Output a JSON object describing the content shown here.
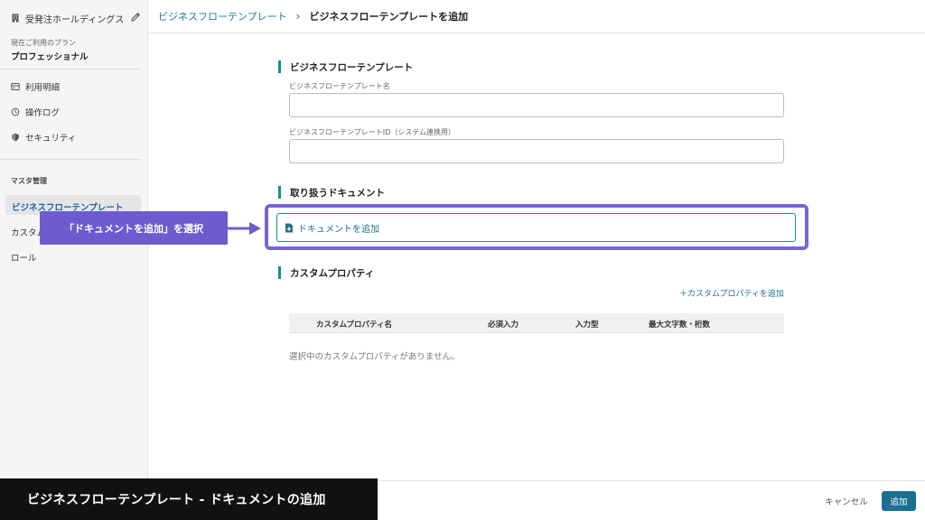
{
  "sidebar": {
    "org_name": "受発注ホールディングス",
    "plan_label": "現在ご利用のプラン",
    "plan_value": "プロフェッショナル",
    "nav": [
      {
        "label": "利用明細",
        "icon": "billing-icon"
      },
      {
        "label": "操作ログ",
        "icon": "history-icon"
      },
      {
        "label": "セキュリティ",
        "icon": "shield-icon"
      }
    ],
    "master_label": "マスタ管理",
    "master_items": [
      "ビジネスフローテンプレート",
      "カスタム",
      "ロール"
    ],
    "active_index": 0
  },
  "breadcrumb": {
    "parent": "ビジネスフローテンプレート",
    "current": "ビジネスフローテンプレートを追加"
  },
  "form": {
    "section1_title": "ビジネスフローテンプレート",
    "name_label": "ビジネスフローテンプレート名",
    "name_value": "",
    "id_label": "ビジネスフローテンプレートID（システム連携用）",
    "id_value": "",
    "section2_title": "取り扱うドキュメント",
    "add_document_label": "ドキュメントを追加",
    "section3_title": "カスタムプロパティ",
    "add_property_label": "＋カスタムプロパティを追加",
    "table_headers": [
      "カスタムプロパティ名",
      "必須入力",
      "入力型",
      "最大文字数・桁数"
    ],
    "empty_message": "選択中のカスタムプロパティがありません。"
  },
  "callout": {
    "text": "「ドキュメントを追加」を選択",
    "color": "#6d5bd0"
  },
  "footer": {
    "caption": "ビジネスフローテンプレート - ドキュメントの追加",
    "cancel_label": "キャンセル",
    "submit_label": "追加"
  },
  "colors": {
    "accent": "#1a8c8c",
    "link": "#1f6f8b",
    "primary_button": "#1a6f93",
    "highlight": "#7b63d6"
  }
}
